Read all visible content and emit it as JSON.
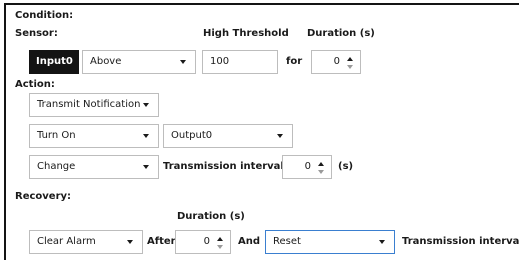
{
  "condition": {
    "title": "Condition:",
    "sensor_label": "Sensor:",
    "high_threshold_label": "High Threshold",
    "duration_label": "Duration (s)",
    "sensor_value": "Input0",
    "comparison": "Above",
    "threshold_value": "100",
    "for_label": "for",
    "duration_value": "0"
  },
  "action": {
    "title": "Action:",
    "notification": "Transmit Notification",
    "turn_on": "Turn On",
    "output": "Output0",
    "change": "Change",
    "transmission_interval_label": "Transmission interval to",
    "interval_value": "0",
    "interval_unit": "(s)"
  },
  "recovery": {
    "title": "Recovery:",
    "duration_label": "Duration (s)",
    "clear_alarm": "Clear Alarm",
    "after_label": "After",
    "duration_value": "0",
    "and_label": "And",
    "reset": "Reset",
    "transmission_interval_label": "Transmission interval"
  },
  "colors": {
    "dark_box": "#141414",
    "border": "#bdbdbd",
    "focus_border": "#3a7fd0"
  }
}
